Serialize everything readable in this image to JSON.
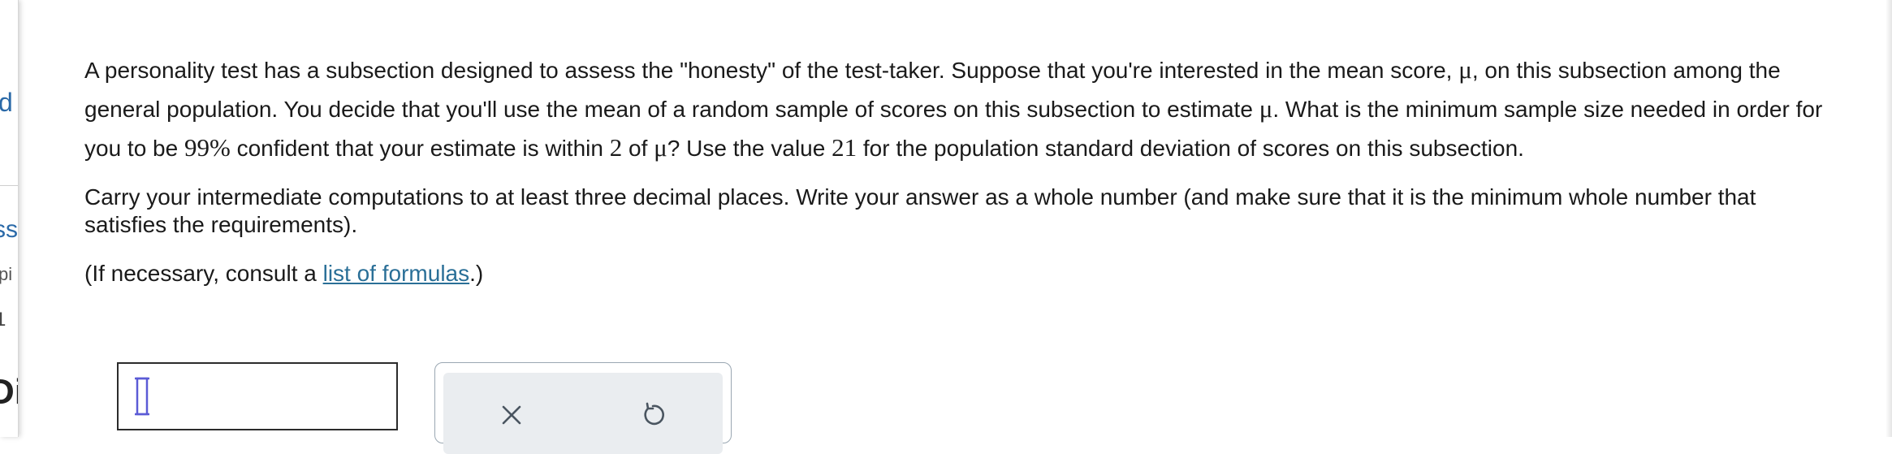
{
  "sidebar": {
    "fragments": {
      "d": "d",
      "ss": "ss",
      "pi": "pi",
      "num": "1",
      "bold": "Di"
    }
  },
  "question": {
    "p1": {
      "t1": "A personality test has a subsection designed to assess the \"honesty\" of the test-taker. Suppose that you're interested in the mean score, ",
      "mu1": "μ",
      "t2": ", on this subsection among the general population. You decide that you'll use the mean of a random sample of scores on this subsection to estimate ",
      "mu2": "μ",
      "t3": ". What is the minimum sample size needed in order for you to be ",
      "confidence": "99%",
      "t4": " confident that your estimate is within ",
      "margin": "2",
      "t5": " of ",
      "mu3": "μ",
      "t6": "? Use the value ",
      "sigma": "21",
      "t7": " for the population standard deviation of scores on this subsection."
    },
    "p2": "Carry your intermediate computations to at least three decimal places. Write your answer as a whole number (and make sure that it is the minimum whole number that satisfies the requirements).",
    "p3": {
      "prefix": "(If necessary, consult a ",
      "link": "list of formulas",
      "suffix": ".)"
    }
  },
  "answer": {
    "value": "",
    "placeholder": ""
  },
  "tools": {
    "clear_icon": "x-icon",
    "undo_icon": "undo-icon"
  },
  "colors": {
    "link": "#2a6f97",
    "cursor_icon": "#5b5bd6",
    "tool_bg": "#eaedf0",
    "icon": "#4a5560"
  }
}
